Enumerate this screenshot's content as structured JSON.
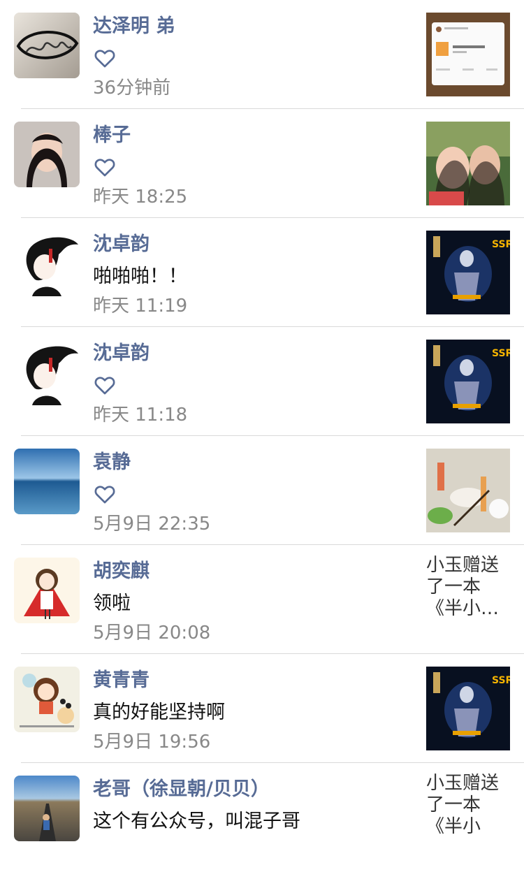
{
  "messages": [
    {
      "name": "达泽明 弟",
      "content": "",
      "like": true,
      "time": "36分钟前",
      "thumb": "book-card-image"
    },
    {
      "name": "棒子",
      "content": "",
      "like": true,
      "time": "昨天 18:25",
      "thumb": "selfie-photo"
    },
    {
      "name": "沈卓韵",
      "content": "啪啪啪！！",
      "like": false,
      "time": "昨天 11:19",
      "thumb": "game-ssr-image"
    },
    {
      "name": "沈卓韵",
      "content": "",
      "like": true,
      "time": "昨天 11:18",
      "thumb": "game-ssr-image"
    },
    {
      "name": "袁静",
      "content": "",
      "like": true,
      "time": "5月9日 22:35",
      "thumb": "food-photo"
    },
    {
      "name": "胡奕麒",
      "content": "领啦",
      "like": false,
      "time": "5月9日 20:08",
      "thumb_text": [
        "小玉赠送",
        "了一本",
        "《半小…"
      ]
    },
    {
      "name": "黄青青",
      "content": "真的好能坚持啊",
      "like": false,
      "time": "5月9日 19:56",
      "thumb": "game-ssr-image"
    },
    {
      "name": "老哥（徐显朝/贝贝）",
      "content": "这个有公众号，叫混子哥",
      "like": false,
      "time": "",
      "thumb_text": [
        "小玉赠送",
        "了一本",
        "《半小"
      ]
    }
  ],
  "colors": {
    "name": "#576b95",
    "time": "#888888",
    "separator": "#d9d9d9"
  },
  "icons": {
    "like": "heart-outline-icon"
  }
}
